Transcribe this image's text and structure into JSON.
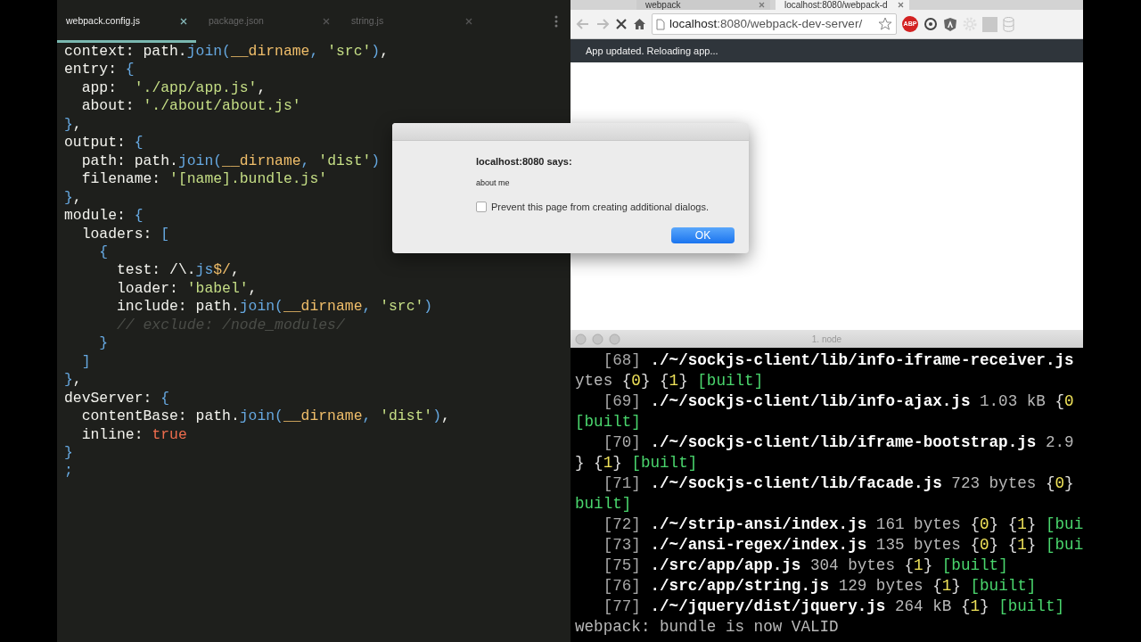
{
  "editor": {
    "tabs": [
      {
        "label": "webpack.config.js",
        "selected": true
      },
      {
        "label": "package.json",
        "selected": false
      },
      {
        "label": "string.js",
        "selected": false
      }
    ],
    "lines": [
      [
        {
          "text": "context: path.",
          "kind": "plain"
        },
        {
          "text": "join",
          "kind": "func"
        },
        {
          "text": "(",
          "kind": "punct"
        },
        {
          "text": "__dirname",
          "kind": "var"
        },
        {
          "text": ", ",
          "kind": "punct"
        },
        {
          "text": "'src'",
          "kind": "string"
        },
        {
          "text": ")",
          "kind": "punct"
        },
        {
          "text": ",",
          "kind": "plain"
        }
      ],
      [
        {
          "text": "entry: ",
          "kind": "plain"
        },
        {
          "text": "{",
          "kind": "punct"
        }
      ],
      [
        {
          "text": "  app:  ",
          "kind": "plain"
        },
        {
          "text": "'./app/app.js'",
          "kind": "string"
        },
        {
          "text": ",",
          "kind": "plain"
        }
      ],
      [
        {
          "text": "  about: ",
          "kind": "plain"
        },
        {
          "text": "'./about/about.js'",
          "kind": "string"
        }
      ],
      [
        {
          "text": "}",
          "kind": "punct"
        },
        {
          "text": ",",
          "kind": "plain"
        }
      ],
      [
        {
          "text": "output: ",
          "kind": "plain"
        },
        {
          "text": "{",
          "kind": "punct"
        }
      ],
      [
        {
          "text": "  path: path.",
          "kind": "plain"
        },
        {
          "text": "join",
          "kind": "func"
        },
        {
          "text": "(",
          "kind": "punct"
        },
        {
          "text": "__dirname",
          "kind": "var"
        },
        {
          "text": ", ",
          "kind": "punct"
        },
        {
          "text": "'dist'",
          "kind": "string"
        },
        {
          "text": ")",
          "kind": "punct"
        }
      ],
      [
        {
          "text": "  filename: ",
          "kind": "plain"
        },
        {
          "text": "'[name].bundle.js'",
          "kind": "string"
        }
      ],
      [
        {
          "text": "}",
          "kind": "punct"
        },
        {
          "text": ",",
          "kind": "plain"
        }
      ],
      [
        {
          "text": "module: ",
          "kind": "plain"
        },
        {
          "text": "{",
          "kind": "punct"
        }
      ],
      [
        {
          "text": "  loaders: ",
          "kind": "plain"
        },
        {
          "text": "[",
          "kind": "punct"
        }
      ],
      [
        {
          "text": "    {",
          "kind": "punct"
        }
      ],
      [
        {
          "text": "      test: ",
          "kind": "plain"
        },
        {
          "text": "/\\.",
          "kind": "plain"
        },
        {
          "text": "js",
          "kind": "func"
        },
        {
          "text": "$/",
          "kind": "var"
        },
        {
          "text": ",",
          "kind": "plain"
        }
      ],
      [
        {
          "text": "      loader: ",
          "kind": "plain"
        },
        {
          "text": "'babel'",
          "kind": "string"
        },
        {
          "text": ",",
          "kind": "plain"
        }
      ],
      [
        {
          "text": "      include: path.",
          "kind": "plain"
        },
        {
          "text": "join",
          "kind": "func"
        },
        {
          "text": "(",
          "kind": "punct"
        },
        {
          "text": "__dirname",
          "kind": "var"
        },
        {
          "text": ", ",
          "kind": "punct"
        },
        {
          "text": "'src'",
          "kind": "string"
        },
        {
          "text": ")",
          "kind": "punct"
        }
      ],
      [
        {
          "text": "      // exclude: /node_modules/",
          "kind": "comment"
        }
      ],
      [
        {
          "text": "    }",
          "kind": "punct"
        }
      ],
      [
        {
          "text": "  ]",
          "kind": "punct"
        }
      ],
      [
        {
          "text": "}",
          "kind": "punct"
        },
        {
          "text": ",",
          "kind": "plain"
        }
      ],
      [
        {
          "text": "devServer: ",
          "kind": "plain"
        },
        {
          "text": "{",
          "kind": "punct"
        }
      ],
      [
        {
          "text": "  contentBase: path.",
          "kind": "plain"
        },
        {
          "text": "join",
          "kind": "func"
        },
        {
          "text": "(",
          "kind": "punct"
        },
        {
          "text": "__dirname",
          "kind": "var"
        },
        {
          "text": ", ",
          "kind": "punct"
        },
        {
          "text": "'dist'",
          "kind": "string"
        },
        {
          "text": ")",
          "kind": "punct"
        },
        {
          "text": ",",
          "kind": "plain"
        }
      ],
      [
        {
          "text": "  inline: ",
          "kind": "plain"
        },
        {
          "text": "true",
          "kind": "literal"
        }
      ],
      [
        {
          "text": "}",
          "kind": "punct"
        }
      ],
      [
        {
          "text": ";",
          "kind": "punct"
        }
      ]
    ]
  },
  "browser": {
    "tabs": [
      {
        "label": "webpack",
        "selected": false
      },
      {
        "label": "localhost:8080/webpack-d",
        "selected": true
      }
    ],
    "address": {
      "host": "localhost",
      "path": ":8080/webpack-dev-server/"
    },
    "extension_label": "ABP",
    "notice": "App updated. Reloading app..."
  },
  "dialog": {
    "title": "localhost:8080 says:",
    "message": "about me",
    "checkbox": {
      "label": "Prevent this page from creating additional dialogs.",
      "checked": false
    },
    "button": "OK"
  },
  "terminal": {
    "title": "1. node",
    "lines": [
      [
        {
          "text": "   [68]",
          "kind": "id"
        },
        {
          "text": " ./~/sockjs-client/lib/info-iframe-receiver.js",
          "kind": "file"
        }
      ],
      [
        {
          "text": "ytes ",
          "kind": "size"
        },
        {
          "text": "{",
          "kind": "brace"
        },
        {
          "text": "0",
          "kind": "chunk"
        },
        {
          "text": "} {",
          "kind": "brace"
        },
        {
          "text": "1",
          "kind": "chunk"
        },
        {
          "text": "} ",
          "kind": "brace"
        },
        {
          "text": "[built]",
          "kind": "status"
        }
      ],
      [
        {
          "text": "   [69]",
          "kind": "id"
        },
        {
          "text": " ./~/sockjs-client/lib/info-ajax.js",
          "kind": "file"
        },
        {
          "text": " 1.03 kB ",
          "kind": "size"
        },
        {
          "text": "{",
          "kind": "brace"
        },
        {
          "text": "0",
          "kind": "chunk"
        }
      ],
      [
        {
          "text": "[built]",
          "kind": "status"
        }
      ],
      [
        {
          "text": "   [70]",
          "kind": "id"
        },
        {
          "text": " ./~/sockjs-client/lib/iframe-bootstrap.js",
          "kind": "file"
        },
        {
          "text": " 2.9",
          "kind": "size"
        }
      ],
      [
        {
          "text": "} {",
          "kind": "brace"
        },
        {
          "text": "1",
          "kind": "chunk"
        },
        {
          "text": "} ",
          "kind": "brace"
        },
        {
          "text": "[built]",
          "kind": "status"
        }
      ],
      [
        {
          "text": "   [71]",
          "kind": "id"
        },
        {
          "text": " ./~/sockjs-client/lib/facade.js",
          "kind": "file"
        },
        {
          "text": " 723 bytes ",
          "kind": "size"
        },
        {
          "text": "{",
          "kind": "brace"
        },
        {
          "text": "0",
          "kind": "chunk"
        },
        {
          "text": "}",
          "kind": "brace"
        }
      ],
      [
        {
          "text": "built]",
          "kind": "status"
        }
      ],
      [
        {
          "text": "   [72]",
          "kind": "id"
        },
        {
          "text": " ./~/strip-ansi/index.js",
          "kind": "file"
        },
        {
          "text": " 161 bytes ",
          "kind": "size"
        },
        {
          "text": "{",
          "kind": "brace"
        },
        {
          "text": "0",
          "kind": "chunk"
        },
        {
          "text": "} {",
          "kind": "brace"
        },
        {
          "text": "1",
          "kind": "chunk"
        },
        {
          "text": "} ",
          "kind": "brace"
        },
        {
          "text": "[bui",
          "kind": "status"
        }
      ],
      [
        {
          "text": "   [73]",
          "kind": "id"
        },
        {
          "text": " ./~/ansi-regex/index.js",
          "kind": "file"
        },
        {
          "text": " 135 bytes ",
          "kind": "size"
        },
        {
          "text": "{",
          "kind": "brace"
        },
        {
          "text": "0",
          "kind": "chunk"
        },
        {
          "text": "} {",
          "kind": "brace"
        },
        {
          "text": "1",
          "kind": "chunk"
        },
        {
          "text": "} ",
          "kind": "brace"
        },
        {
          "text": "[bui",
          "kind": "status"
        }
      ],
      [
        {
          "text": "   [75]",
          "kind": "id"
        },
        {
          "text": " ./src/app/app.js",
          "kind": "file"
        },
        {
          "text": " 304 bytes ",
          "kind": "size"
        },
        {
          "text": "{",
          "kind": "brace"
        },
        {
          "text": "1",
          "kind": "chunk"
        },
        {
          "text": "} ",
          "kind": "brace"
        },
        {
          "text": "[built]",
          "kind": "status"
        }
      ],
      [
        {
          "text": "   [76]",
          "kind": "id"
        },
        {
          "text": " ./src/app/string.js",
          "kind": "file"
        },
        {
          "text": " 129 bytes ",
          "kind": "size"
        },
        {
          "text": "{",
          "kind": "brace"
        },
        {
          "text": "1",
          "kind": "chunk"
        },
        {
          "text": "} ",
          "kind": "brace"
        },
        {
          "text": "[built]",
          "kind": "status"
        }
      ],
      [
        {
          "text": "   [77]",
          "kind": "id"
        },
        {
          "text": " ./~/jquery/dist/jquery.js",
          "kind": "file"
        },
        {
          "text": " 264 kB ",
          "kind": "size"
        },
        {
          "text": "{",
          "kind": "brace"
        },
        {
          "text": "1",
          "kind": "chunk"
        },
        {
          "text": "} ",
          "kind": "brace"
        },
        {
          "text": "[built]",
          "kind": "status"
        }
      ],
      [
        {
          "text": "webpack: bundle is now VALID",
          "kind": "size"
        }
      ]
    ]
  }
}
